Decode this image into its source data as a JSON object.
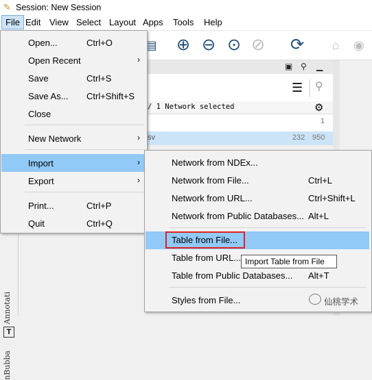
{
  "window": {
    "title": "Session: New Session"
  },
  "menubar": [
    "File",
    "Edit",
    "View",
    "Select",
    "Layout",
    "Apps",
    "Tools",
    "Help"
  ],
  "file_menu": {
    "items": [
      {
        "label": "Open...",
        "shortcut": "Ctrl+O"
      },
      {
        "label": "Open Recent",
        "submenu": true
      },
      {
        "label": "Save",
        "shortcut": "Ctrl+S"
      },
      {
        "label": "Save As...",
        "shortcut": "Ctrl+Shift+S"
      },
      {
        "label": "Close"
      },
      {
        "label": "New Network",
        "submenu": true
      },
      {
        "label": "Import",
        "submenu": true,
        "highlighted": true
      },
      {
        "label": "Export",
        "submenu": true
      },
      {
        "label": "Print...",
        "shortcut": "Ctrl+P"
      },
      {
        "label": "Quit",
        "shortcut": "Ctrl+Q"
      }
    ]
  },
  "import_menu": {
    "items": [
      {
        "label": "Network from NDEx..."
      },
      {
        "label": "Network from File...",
        "shortcut": "Ctrl+L"
      },
      {
        "label": "Network from URL...",
        "shortcut": "Ctrl+Shift+L"
      },
      {
        "label": "Network from Public Databases...",
        "shortcut": "Alt+L"
      },
      {
        "label": "Table from File...",
        "highlighted": true
      },
      {
        "label": "Table from URL..."
      },
      {
        "label": "Table from Public Databases...",
        "shortcut": "Alt+T"
      },
      {
        "label": "Styles from File..."
      }
    ]
  },
  "tooltip": "Import Table from File",
  "network_panel": {
    "status": "/ 1 Network selected",
    "row1_count": "1",
    "row2": {
      "name": "sv",
      "nodes": "232",
      "edges": "950"
    }
  },
  "left_strip": {
    "annotation_label": "Annotati",
    "bubba_label": "nBubba"
  },
  "watermark": "仙桃学术",
  "toolbar_icons": [
    "table-icon",
    "zoom-in-icon",
    "zoom-out-icon",
    "zoom-fit-icon",
    "zoom-selected-icon",
    "refresh-icon",
    "home-icon",
    "hide-icon"
  ],
  "colors": {
    "highlight": "#91c9f7",
    "selected_row": "#cce4f7",
    "menu_bg": "#f2f2f2",
    "callout_box": "#e02020"
  }
}
